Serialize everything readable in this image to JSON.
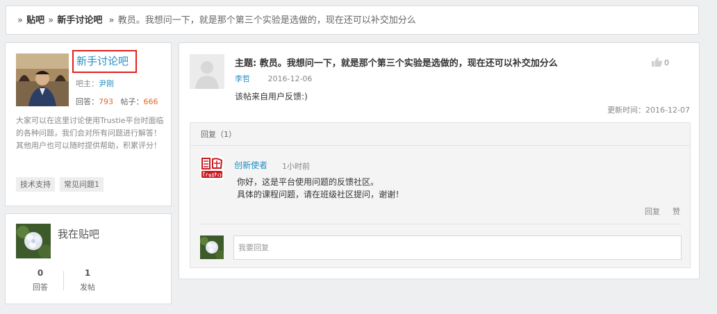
{
  "breadcrumb": {
    "root": "贴吧",
    "forum": "新手讨论吧",
    "current": "教员。我想问一下，就是那个第三个实验是选做的，现在还可以补交加分么"
  },
  "forum": {
    "name": "新手讨论吧",
    "owner_label": "吧主：",
    "owner": "尹刚",
    "answers_label": "回答：",
    "answers": "793",
    "posts_label": "帖子：",
    "posts": "666",
    "description": "大家可以在这里讨论使用Trustie平台时面临的各种问题，我们会对所有问题进行解答！其他用户也可以随时提供帮助，积累评分！",
    "tags": [
      "技术支持",
      "常见问题1"
    ]
  },
  "me": {
    "title": "我在贴吧",
    "answers_value": "0",
    "answers_label": "回答",
    "posts_value": "1",
    "posts_label": "发帖"
  },
  "post": {
    "title": "主题: 教员。我想问一下，就是那个第三个实验是选做的，现在还可以补交加分么",
    "likes": "0",
    "author": "李哲",
    "date": "2016-12-06",
    "body": "该帖来自用户反馈:)",
    "updated": "更新时间：2016-12-07"
  },
  "replies": {
    "header": "回复（1）",
    "items": [
      {
        "author": "创新使者",
        "time": "1小时前",
        "line1": "你好，这是平台使用问题的反馈社区。",
        "line2": "具体的课程问题，请在班级社区提问，谢谢！",
        "reply_label": "回复",
        "like_label": "赞"
      }
    ],
    "input_placeholder": "我要回复"
  },
  "colors": {
    "link": "#1f8ec5",
    "count": "#e8641f",
    "highlight_border": "#e0201b"
  }
}
